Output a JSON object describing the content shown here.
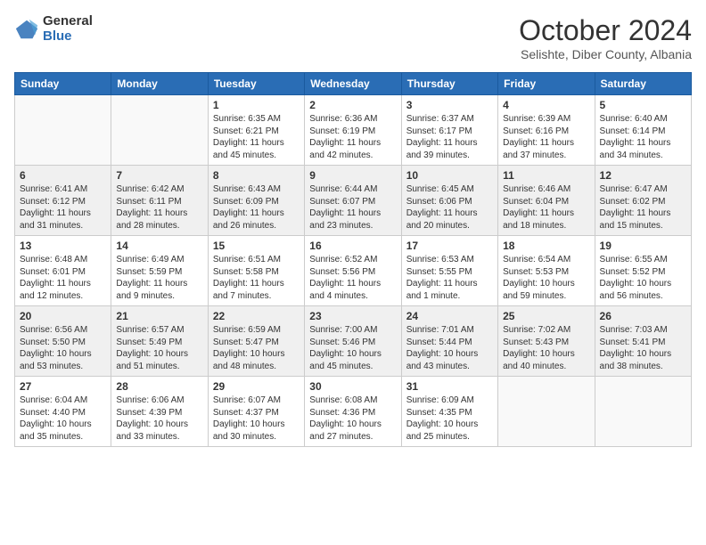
{
  "logo": {
    "general": "General",
    "blue": "Blue"
  },
  "title": "October 2024",
  "location": "Selishte, Diber County, Albania",
  "headers": [
    "Sunday",
    "Monday",
    "Tuesday",
    "Wednesday",
    "Thursday",
    "Friday",
    "Saturday"
  ],
  "weeks": [
    [
      {
        "day": "",
        "info": ""
      },
      {
        "day": "",
        "info": ""
      },
      {
        "day": "1",
        "info": "Sunrise: 6:35 AM\nSunset: 6:21 PM\nDaylight: 11 hours and 45 minutes."
      },
      {
        "day": "2",
        "info": "Sunrise: 6:36 AM\nSunset: 6:19 PM\nDaylight: 11 hours and 42 minutes."
      },
      {
        "day": "3",
        "info": "Sunrise: 6:37 AM\nSunset: 6:17 PM\nDaylight: 11 hours and 39 minutes."
      },
      {
        "day": "4",
        "info": "Sunrise: 6:39 AM\nSunset: 6:16 PM\nDaylight: 11 hours and 37 minutes."
      },
      {
        "day": "5",
        "info": "Sunrise: 6:40 AM\nSunset: 6:14 PM\nDaylight: 11 hours and 34 minutes."
      }
    ],
    [
      {
        "day": "6",
        "info": "Sunrise: 6:41 AM\nSunset: 6:12 PM\nDaylight: 11 hours and 31 minutes."
      },
      {
        "day": "7",
        "info": "Sunrise: 6:42 AM\nSunset: 6:11 PM\nDaylight: 11 hours and 28 minutes."
      },
      {
        "day": "8",
        "info": "Sunrise: 6:43 AM\nSunset: 6:09 PM\nDaylight: 11 hours and 26 minutes."
      },
      {
        "day": "9",
        "info": "Sunrise: 6:44 AM\nSunset: 6:07 PM\nDaylight: 11 hours and 23 minutes."
      },
      {
        "day": "10",
        "info": "Sunrise: 6:45 AM\nSunset: 6:06 PM\nDaylight: 11 hours and 20 minutes."
      },
      {
        "day": "11",
        "info": "Sunrise: 6:46 AM\nSunset: 6:04 PM\nDaylight: 11 hours and 18 minutes."
      },
      {
        "day": "12",
        "info": "Sunrise: 6:47 AM\nSunset: 6:02 PM\nDaylight: 11 hours and 15 minutes."
      }
    ],
    [
      {
        "day": "13",
        "info": "Sunrise: 6:48 AM\nSunset: 6:01 PM\nDaylight: 11 hours and 12 minutes."
      },
      {
        "day": "14",
        "info": "Sunrise: 6:49 AM\nSunset: 5:59 PM\nDaylight: 11 hours and 9 minutes."
      },
      {
        "day": "15",
        "info": "Sunrise: 6:51 AM\nSunset: 5:58 PM\nDaylight: 11 hours and 7 minutes."
      },
      {
        "day": "16",
        "info": "Sunrise: 6:52 AM\nSunset: 5:56 PM\nDaylight: 11 hours and 4 minutes."
      },
      {
        "day": "17",
        "info": "Sunrise: 6:53 AM\nSunset: 5:55 PM\nDaylight: 11 hours and 1 minute."
      },
      {
        "day": "18",
        "info": "Sunrise: 6:54 AM\nSunset: 5:53 PM\nDaylight: 10 hours and 59 minutes."
      },
      {
        "day": "19",
        "info": "Sunrise: 6:55 AM\nSunset: 5:52 PM\nDaylight: 10 hours and 56 minutes."
      }
    ],
    [
      {
        "day": "20",
        "info": "Sunrise: 6:56 AM\nSunset: 5:50 PM\nDaylight: 10 hours and 53 minutes."
      },
      {
        "day": "21",
        "info": "Sunrise: 6:57 AM\nSunset: 5:49 PM\nDaylight: 10 hours and 51 minutes."
      },
      {
        "day": "22",
        "info": "Sunrise: 6:59 AM\nSunset: 5:47 PM\nDaylight: 10 hours and 48 minutes."
      },
      {
        "day": "23",
        "info": "Sunrise: 7:00 AM\nSunset: 5:46 PM\nDaylight: 10 hours and 45 minutes."
      },
      {
        "day": "24",
        "info": "Sunrise: 7:01 AM\nSunset: 5:44 PM\nDaylight: 10 hours and 43 minutes."
      },
      {
        "day": "25",
        "info": "Sunrise: 7:02 AM\nSunset: 5:43 PM\nDaylight: 10 hours and 40 minutes."
      },
      {
        "day": "26",
        "info": "Sunrise: 7:03 AM\nSunset: 5:41 PM\nDaylight: 10 hours and 38 minutes."
      }
    ],
    [
      {
        "day": "27",
        "info": "Sunrise: 6:04 AM\nSunset: 4:40 PM\nDaylight: 10 hours and 35 minutes."
      },
      {
        "day": "28",
        "info": "Sunrise: 6:06 AM\nSunset: 4:39 PM\nDaylight: 10 hours and 33 minutes."
      },
      {
        "day": "29",
        "info": "Sunrise: 6:07 AM\nSunset: 4:37 PM\nDaylight: 10 hours and 30 minutes."
      },
      {
        "day": "30",
        "info": "Sunrise: 6:08 AM\nSunset: 4:36 PM\nDaylight: 10 hours and 27 minutes."
      },
      {
        "day": "31",
        "info": "Sunrise: 6:09 AM\nSunset: 4:35 PM\nDaylight: 10 hours and 25 minutes."
      },
      {
        "day": "",
        "info": ""
      },
      {
        "day": "",
        "info": ""
      }
    ]
  ]
}
